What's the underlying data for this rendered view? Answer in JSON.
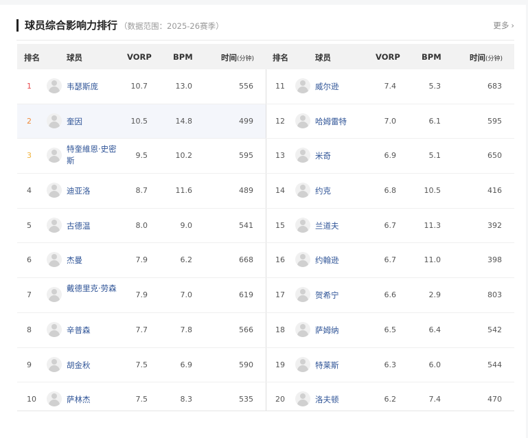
{
  "header": {
    "title": "球员综合影响力排行",
    "subtitle": "（数据范围：2025-26赛季）",
    "more_label": "更多",
    "more_icon": "chevron-right-icon"
  },
  "columns": {
    "rank": "排名",
    "player": "球员",
    "vorp": "VORP",
    "bpm": "BPM",
    "time": "时间",
    "time_unit": "(分钟)"
  },
  "colors": {
    "rank1": "#e8484c",
    "rank2": "#ef8a3b",
    "rank3": "#f0b23a",
    "name_link": "#2f5497"
  },
  "left": [
    {
      "rank": "1",
      "name": "韦瑟斯庞",
      "vorp": "10.7",
      "bpm": "13.0",
      "time": "556"
    },
    {
      "rank": "2",
      "name": "奎因",
      "vorp": "10.5",
      "bpm": "14.8",
      "time": "499"
    },
    {
      "rank": "3",
      "name": "特奎維恩·史密斯",
      "vorp": "9.5",
      "bpm": "10.2",
      "time": "595"
    },
    {
      "rank": "4",
      "name": "迪亚洛",
      "vorp": "8.7",
      "bpm": "11.6",
      "time": "489"
    },
    {
      "rank": "5",
      "name": "古德温",
      "vorp": "8.0",
      "bpm": "9.0",
      "time": "541"
    },
    {
      "rank": "6",
      "name": "杰曼",
      "vorp": "7.9",
      "bpm": "6.2",
      "time": "668"
    },
    {
      "rank": "7",
      "name": "戴德里克·劳森",
      "vorp": "7.9",
      "bpm": "7.0",
      "time": "619"
    },
    {
      "rank": "8",
      "name": "辛普森",
      "vorp": "7.7",
      "bpm": "7.8",
      "time": "566"
    },
    {
      "rank": "9",
      "name": "胡金秋",
      "vorp": "7.5",
      "bpm": "6.9",
      "time": "590"
    },
    {
      "rank": "10",
      "name": "萨林杰",
      "vorp": "7.5",
      "bpm": "8.3",
      "time": "535"
    }
  ],
  "right": [
    {
      "rank": "11",
      "name": "威尔逊",
      "vorp": "7.4",
      "bpm": "5.3",
      "time": "683"
    },
    {
      "rank": "12",
      "name": "哈姆雷特",
      "vorp": "7.0",
      "bpm": "6.1",
      "time": "595"
    },
    {
      "rank": "13",
      "name": "米奇",
      "vorp": "6.9",
      "bpm": "5.1",
      "time": "650"
    },
    {
      "rank": "14",
      "name": "约克",
      "vorp": "6.8",
      "bpm": "10.5",
      "time": "416"
    },
    {
      "rank": "15",
      "name": "兰道夫",
      "vorp": "6.7",
      "bpm": "11.3",
      "time": "392"
    },
    {
      "rank": "16",
      "name": "约翰逊",
      "vorp": "6.7",
      "bpm": "11.0",
      "time": "398"
    },
    {
      "rank": "17",
      "name": "贺希宁",
      "vorp": "6.6",
      "bpm": "2.9",
      "time": "803"
    },
    {
      "rank": "18",
      "name": "萨姆纳",
      "vorp": "6.5",
      "bpm": "6.4",
      "time": "542"
    },
    {
      "rank": "19",
      "name": "特莱斯",
      "vorp": "6.3",
      "bpm": "6.0",
      "time": "544"
    },
    {
      "rank": "20",
      "name": "洛夫顿",
      "vorp": "6.2",
      "bpm": "7.4",
      "time": "470"
    }
  ]
}
